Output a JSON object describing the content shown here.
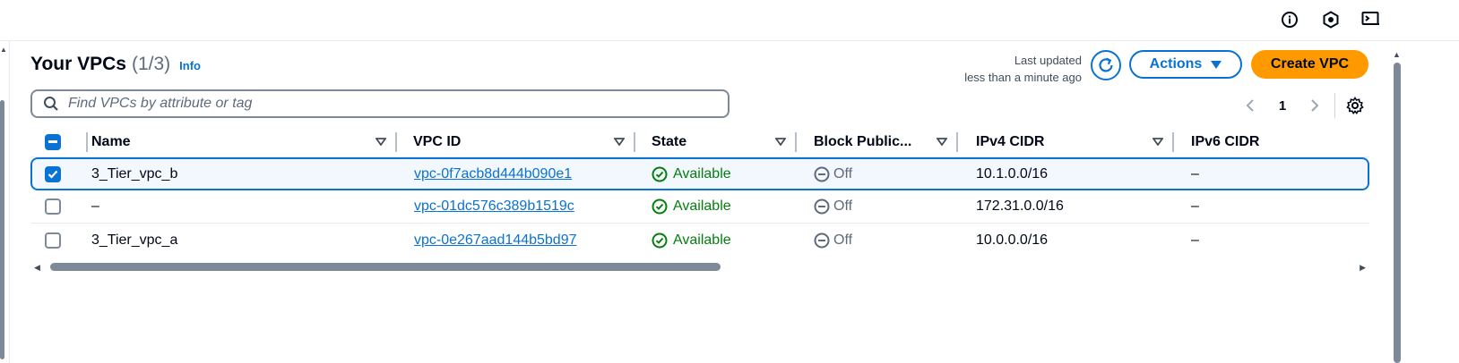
{
  "header": {
    "title": "Your VPCs",
    "count": "(1/3)",
    "info_link": "Info",
    "last_updated_line1": "Last updated",
    "last_updated_line2": "less than a minute ago",
    "actions_label": "Actions",
    "create_label": "Create VPC"
  },
  "search": {
    "placeholder": "Find VPCs by attribute or tag",
    "value": ""
  },
  "pagination": {
    "current_page": "1"
  },
  "columns": [
    "Name",
    "VPC ID",
    "State",
    "Block Public...",
    "IPv4 CIDR",
    "IPv6 CIDR"
  ],
  "rows": [
    {
      "selected": true,
      "name": "3_Tier_vpc_b",
      "vpc_id": "vpc-0f7acb8d444b090e1",
      "state": "Available",
      "block_public": "Off",
      "ipv4": "10.1.0.0/16",
      "ipv6": "–"
    },
    {
      "selected": false,
      "name": "–",
      "vpc_id": "vpc-01dc576c389b1519c",
      "state": "Available",
      "block_public": "Off",
      "ipv4": "172.31.0.0/16",
      "ipv6": "–"
    },
    {
      "selected": false,
      "name": "3_Tier_vpc_a",
      "vpc_id": "vpc-0e267aad144b5bd97",
      "state": "Available",
      "block_public": "Off",
      "ipv4": "10.0.0.0/16",
      "ipv6": "–"
    }
  ],
  "colors": {
    "link_blue": "#0972d3",
    "primary_orange": "#ff9900",
    "success_green": "#037f0c"
  },
  "icons": {
    "top_bar": [
      "info-icon",
      "settings-hex-icon",
      "cloudshell-icon"
    ],
    "refresh": "refresh-icon",
    "search": "search-icon",
    "preferences": "gear-icon",
    "state_available": "check-circle-icon",
    "block_off": "minus-circle-icon"
  }
}
